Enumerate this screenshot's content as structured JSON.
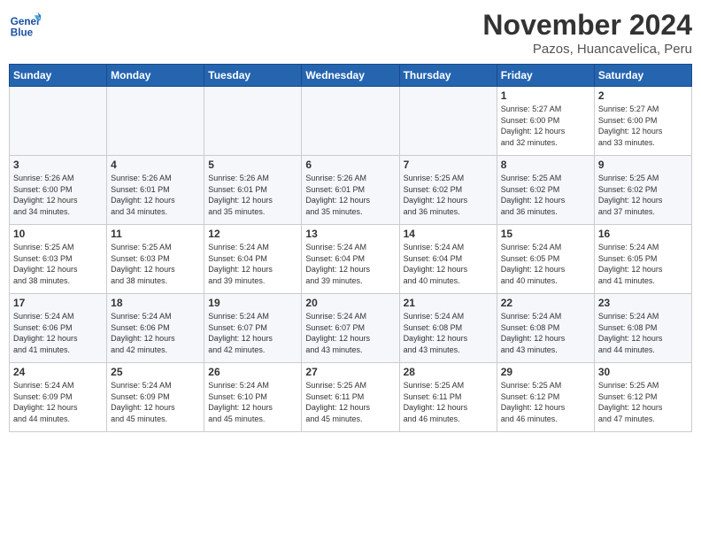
{
  "logo": {
    "line1": "General",
    "line2": "Blue"
  },
  "title": "November 2024",
  "subtitle": "Pazos, Huancavelica, Peru",
  "days_of_week": [
    "Sunday",
    "Monday",
    "Tuesday",
    "Wednesday",
    "Thursday",
    "Friday",
    "Saturday"
  ],
  "weeks": [
    [
      {
        "num": "",
        "info": ""
      },
      {
        "num": "",
        "info": ""
      },
      {
        "num": "",
        "info": ""
      },
      {
        "num": "",
        "info": ""
      },
      {
        "num": "",
        "info": ""
      },
      {
        "num": "1",
        "info": "Sunrise: 5:27 AM\nSunset: 6:00 PM\nDaylight: 12 hours\nand 32 minutes."
      },
      {
        "num": "2",
        "info": "Sunrise: 5:27 AM\nSunset: 6:00 PM\nDaylight: 12 hours\nand 33 minutes."
      }
    ],
    [
      {
        "num": "3",
        "info": "Sunrise: 5:26 AM\nSunset: 6:00 PM\nDaylight: 12 hours\nand 34 minutes."
      },
      {
        "num": "4",
        "info": "Sunrise: 5:26 AM\nSunset: 6:01 PM\nDaylight: 12 hours\nand 34 minutes."
      },
      {
        "num": "5",
        "info": "Sunrise: 5:26 AM\nSunset: 6:01 PM\nDaylight: 12 hours\nand 35 minutes."
      },
      {
        "num": "6",
        "info": "Sunrise: 5:26 AM\nSunset: 6:01 PM\nDaylight: 12 hours\nand 35 minutes."
      },
      {
        "num": "7",
        "info": "Sunrise: 5:25 AM\nSunset: 6:02 PM\nDaylight: 12 hours\nand 36 minutes."
      },
      {
        "num": "8",
        "info": "Sunrise: 5:25 AM\nSunset: 6:02 PM\nDaylight: 12 hours\nand 36 minutes."
      },
      {
        "num": "9",
        "info": "Sunrise: 5:25 AM\nSunset: 6:02 PM\nDaylight: 12 hours\nand 37 minutes."
      }
    ],
    [
      {
        "num": "10",
        "info": "Sunrise: 5:25 AM\nSunset: 6:03 PM\nDaylight: 12 hours\nand 38 minutes."
      },
      {
        "num": "11",
        "info": "Sunrise: 5:25 AM\nSunset: 6:03 PM\nDaylight: 12 hours\nand 38 minutes."
      },
      {
        "num": "12",
        "info": "Sunrise: 5:24 AM\nSunset: 6:04 PM\nDaylight: 12 hours\nand 39 minutes."
      },
      {
        "num": "13",
        "info": "Sunrise: 5:24 AM\nSunset: 6:04 PM\nDaylight: 12 hours\nand 39 minutes."
      },
      {
        "num": "14",
        "info": "Sunrise: 5:24 AM\nSunset: 6:04 PM\nDaylight: 12 hours\nand 40 minutes."
      },
      {
        "num": "15",
        "info": "Sunrise: 5:24 AM\nSunset: 6:05 PM\nDaylight: 12 hours\nand 40 minutes."
      },
      {
        "num": "16",
        "info": "Sunrise: 5:24 AM\nSunset: 6:05 PM\nDaylight: 12 hours\nand 41 minutes."
      }
    ],
    [
      {
        "num": "17",
        "info": "Sunrise: 5:24 AM\nSunset: 6:06 PM\nDaylight: 12 hours\nand 41 minutes."
      },
      {
        "num": "18",
        "info": "Sunrise: 5:24 AM\nSunset: 6:06 PM\nDaylight: 12 hours\nand 42 minutes."
      },
      {
        "num": "19",
        "info": "Sunrise: 5:24 AM\nSunset: 6:07 PM\nDaylight: 12 hours\nand 42 minutes."
      },
      {
        "num": "20",
        "info": "Sunrise: 5:24 AM\nSunset: 6:07 PM\nDaylight: 12 hours\nand 43 minutes."
      },
      {
        "num": "21",
        "info": "Sunrise: 5:24 AM\nSunset: 6:08 PM\nDaylight: 12 hours\nand 43 minutes."
      },
      {
        "num": "22",
        "info": "Sunrise: 5:24 AM\nSunset: 6:08 PM\nDaylight: 12 hours\nand 43 minutes."
      },
      {
        "num": "23",
        "info": "Sunrise: 5:24 AM\nSunset: 6:08 PM\nDaylight: 12 hours\nand 44 minutes."
      }
    ],
    [
      {
        "num": "24",
        "info": "Sunrise: 5:24 AM\nSunset: 6:09 PM\nDaylight: 12 hours\nand 44 minutes."
      },
      {
        "num": "25",
        "info": "Sunrise: 5:24 AM\nSunset: 6:09 PM\nDaylight: 12 hours\nand 45 minutes."
      },
      {
        "num": "26",
        "info": "Sunrise: 5:24 AM\nSunset: 6:10 PM\nDaylight: 12 hours\nand 45 minutes."
      },
      {
        "num": "27",
        "info": "Sunrise: 5:25 AM\nSunset: 6:11 PM\nDaylight: 12 hours\nand 45 minutes."
      },
      {
        "num": "28",
        "info": "Sunrise: 5:25 AM\nSunset: 6:11 PM\nDaylight: 12 hours\nand 46 minutes."
      },
      {
        "num": "29",
        "info": "Sunrise: 5:25 AM\nSunset: 6:12 PM\nDaylight: 12 hours\nand 46 minutes."
      },
      {
        "num": "30",
        "info": "Sunrise: 5:25 AM\nSunset: 6:12 PM\nDaylight: 12 hours\nand 47 minutes."
      }
    ]
  ]
}
